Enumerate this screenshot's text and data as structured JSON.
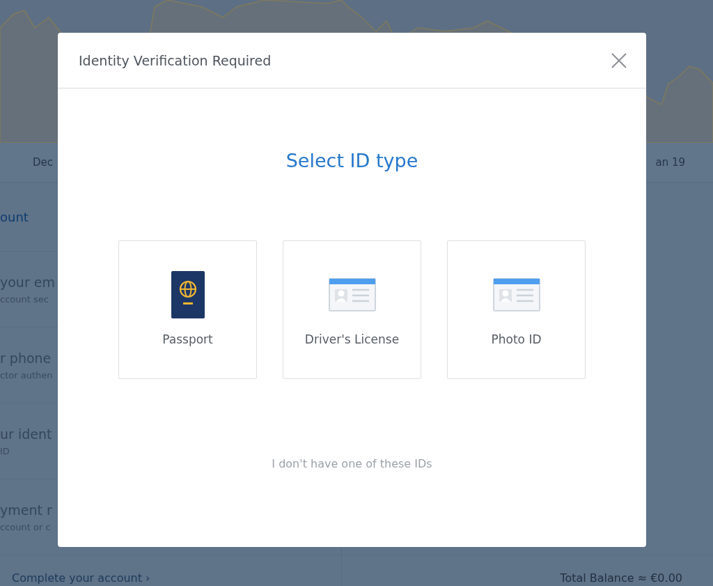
{
  "background": {
    "chart_axis_labels": [
      "Dec",
      "an 19"
    ],
    "account_panel": {
      "title": "ount",
      "items": [
        {
          "title": "your em",
          "subtitle": "ccount sec"
        },
        {
          "title": "r phone",
          "subtitle": "ctor authen"
        },
        {
          "title": "ur ident",
          "subtitle": "ID"
        },
        {
          "title": "yment r",
          "subtitle": "ccount or c"
        }
      ],
      "footer_link": "Complete your account ›"
    },
    "balance": "Total Balance ≈ €0.00"
  },
  "dialog": {
    "title": "Identity Verification Required",
    "heading": "Select ID type",
    "options": [
      {
        "kind": "passport",
        "label": "Passport"
      },
      {
        "kind": "license",
        "label": "Driver's License"
      },
      {
        "kind": "photo_id",
        "label": "Photo ID"
      }
    ],
    "footer_link": "I don't have one of these IDs"
  }
}
